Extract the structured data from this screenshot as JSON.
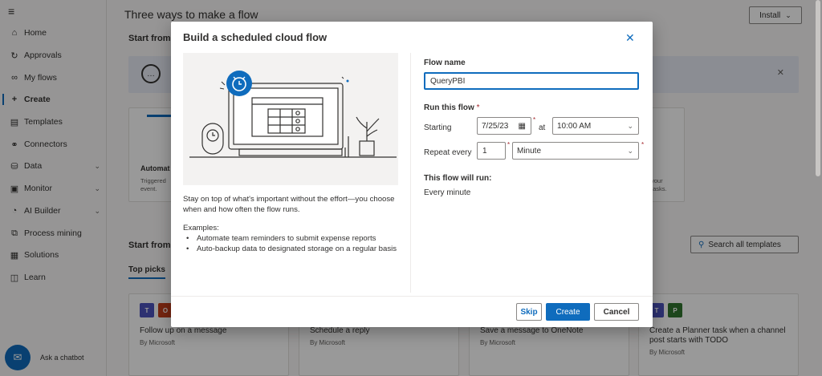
{
  "sidebar": {
    "items": [
      {
        "label": "Home",
        "icon": "home-icon"
      },
      {
        "label": "Approvals",
        "icon": "approvals-icon"
      },
      {
        "label": "My flows",
        "icon": "flows-icon"
      },
      {
        "label": "Create",
        "icon": "plus-icon"
      },
      {
        "label": "Templates",
        "icon": "templates-icon"
      },
      {
        "label": "Connectors",
        "icon": "connectors-icon"
      },
      {
        "label": "Data",
        "icon": "data-icon"
      },
      {
        "label": "Monitor",
        "icon": "monitor-icon"
      },
      {
        "label": "AI Builder",
        "icon": "ai-builder-icon"
      },
      {
        "label": "Process mining",
        "icon": "process-mining-icon"
      },
      {
        "label": "Solutions",
        "icon": "solutions-icon"
      },
      {
        "label": "Learn",
        "icon": "learn-icon"
      }
    ],
    "chatbot_label": "Ask a chatbot"
  },
  "main": {
    "title": "Three ways to make a flow",
    "install_label": "Install",
    "start_from_1": "Start from",
    "start_from_2": "Start from",
    "card_automated": {
      "title": "Automat",
      "sub1": "Triggered",
      "sub2": "event."
    },
    "card_right": {
      "sub1": "your",
      "sub2": "tasks."
    },
    "search_templates": "Search all templates",
    "tab_top_picks": "Top picks",
    "templates": [
      {
        "title": "Follow up on a message",
        "by": "By Microsoft"
      },
      {
        "title": "Schedule a reply",
        "by": "By Microsoft"
      },
      {
        "title": "Save a message to OneNote",
        "by": "By Microsoft"
      },
      {
        "title": "Create a Planner task when a channel post starts with TODO",
        "by": "By Microsoft"
      }
    ]
  },
  "dialog": {
    "title": "Build a scheduled cloud flow",
    "description": "Stay on top of what's important without the effort—you choose when and how often the flow runs.",
    "examples_label": "Examples:",
    "examples": [
      "Automate team reminders to submit expense reports",
      "Auto-backup data to designated storage on a regular basis"
    ],
    "flow_name_label": "Flow name",
    "flow_name_value": "QueryPBI",
    "run_this_flow_label": "Run this flow",
    "required_mark": "*",
    "starting_label": "Starting",
    "start_date": "7/25/23",
    "at_label": "at",
    "start_time": "10:00 AM",
    "repeat_every_label": "Repeat every",
    "repeat_interval": "1",
    "repeat_unit": "Minute",
    "will_run_label": "This flow will run:",
    "will_run_value": "Every minute",
    "buttons": {
      "skip": "Skip",
      "create": "Create",
      "cancel": "Cancel"
    }
  },
  "colors": {
    "accent": "#0f6cbd",
    "required": "#a4262c",
    "overlay": "#000000"
  }
}
